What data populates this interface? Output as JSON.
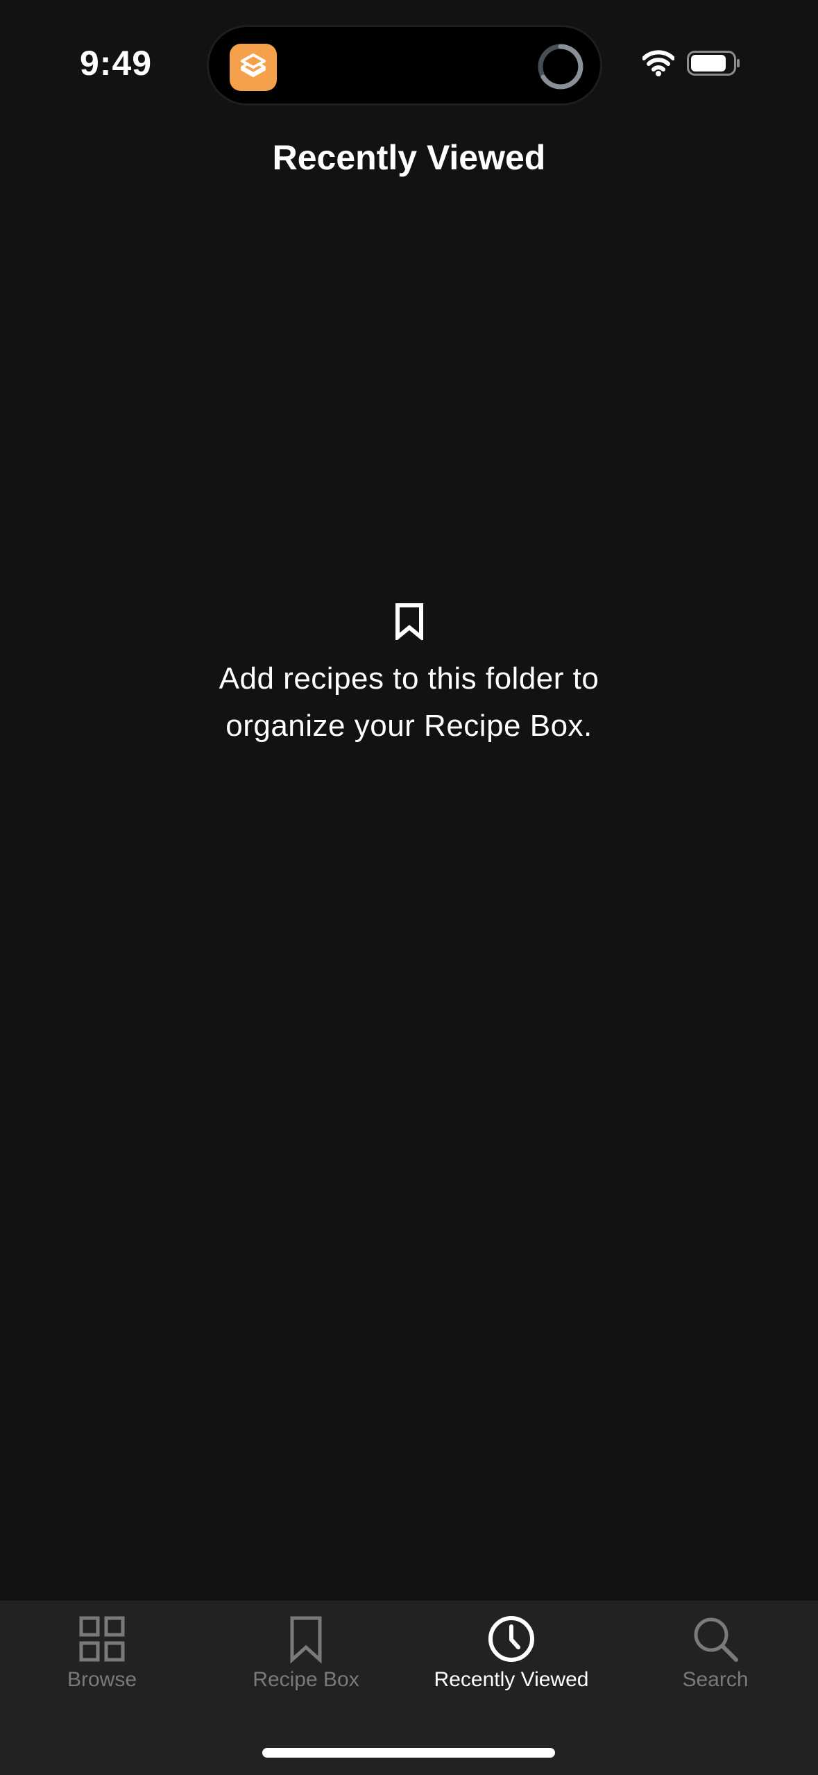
{
  "status_bar": {
    "time": "9:49"
  },
  "nav": {
    "title": "Recently Viewed"
  },
  "empty_state": {
    "icon": "bookmark-icon",
    "line1": "Add recipes to this folder to",
    "line2": "organize your Recipe Box."
  },
  "tab_bar": {
    "tabs": [
      {
        "label": "Browse",
        "icon": "grid-icon",
        "active": false
      },
      {
        "label": "Recipe Box",
        "icon": "bookmark-icon",
        "active": false
      },
      {
        "label": "Recently Viewed",
        "icon": "clock-icon",
        "active": true
      },
      {
        "label": "Search",
        "icon": "search-icon",
        "active": false
      }
    ]
  },
  "colors": {
    "background": "#121212",
    "tab_bar_background": "#222222",
    "inactive_tab": "#7a7a7a",
    "active_tab": "#ffffff",
    "app_icon": "#f5a04a"
  }
}
